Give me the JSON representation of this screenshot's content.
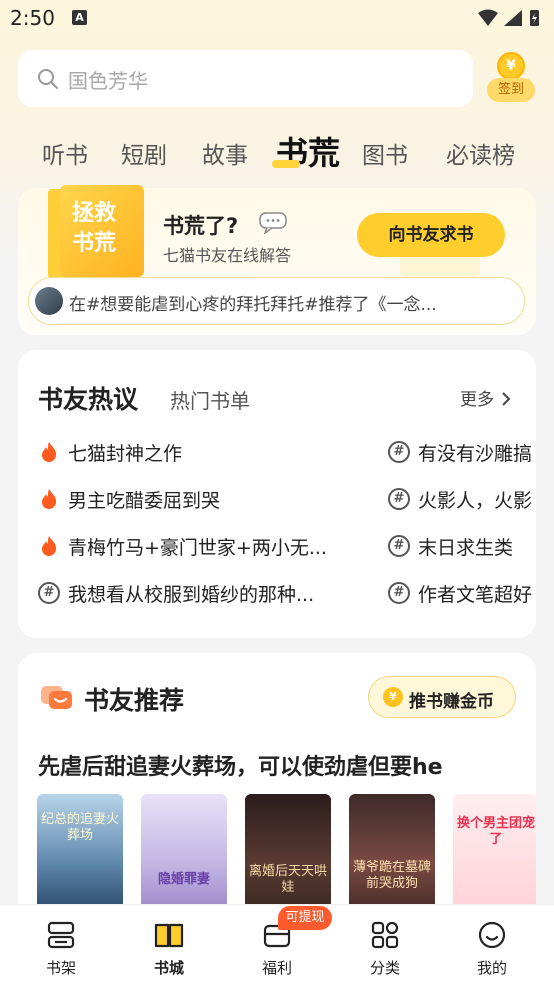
{
  "status_bar": {
    "time": "2:50",
    "notif_icon": "A"
  },
  "search": {
    "placeholder": "国色芳华"
  },
  "signin": {
    "coin": "¥",
    "label": "签到"
  },
  "tabs": [
    {
      "label": "听书"
    },
    {
      "label": "短剧"
    },
    {
      "label": "故事"
    },
    {
      "label": "书荒",
      "active": true
    },
    {
      "label": "图书"
    },
    {
      "label": "必读榜"
    }
  ],
  "rescue": {
    "book_text": "拯救书荒",
    "title": "书荒了?",
    "subtitle": "七猫书友在线解答",
    "ask_button": "向书友求书",
    "marquee": "在#想要能虐到心疼的拜托拜托#推荐了《一念..."
  },
  "discussion": {
    "title": "书友热议",
    "tab2": "热门书单",
    "more": "更多",
    "items_left": [
      {
        "text": "七猫封神之作",
        "icon": "fire-icon"
      },
      {
        "text": "男主吃醋委屈到哭",
        "icon": "fire-icon"
      },
      {
        "text": "青梅竹马+豪门世家+两小无...",
        "icon": "fire-icon"
      },
      {
        "text": "我想看从校服到婚纱的那种...",
        "icon": "hash-icon"
      }
    ],
    "items_right": [
      {
        "text": "有没有沙雕搞",
        "icon": "hash-icon"
      },
      {
        "text": "火影人，火影",
        "icon": "hash-icon"
      },
      {
        "text": "末日求生类",
        "icon": "hash-icon"
      },
      {
        "text": "作者文笔超好",
        "icon": "hash-icon"
      }
    ]
  },
  "recommend": {
    "title": "书友推荐",
    "earn_button": "推书赚金币",
    "list_title": "先虐后甜追妻火葬场，可以使劲虐但要he",
    "covers": [
      {
        "text": "纪总的追妻火葬场"
      },
      {
        "text": "隐婚罪妻"
      },
      {
        "text": "离婚后天天哄娃"
      },
      {
        "text": "薄爷跪在墓碑前哭成狗"
      },
      {
        "text": "换个男主团宠了"
      }
    ]
  },
  "bottom_nav": [
    {
      "label": "书架"
    },
    {
      "label": "书城",
      "active": true
    },
    {
      "label": "福利"
    },
    {
      "label": "分类"
    },
    {
      "label": "我的"
    }
  ],
  "welfare_badge": "可提现"
}
